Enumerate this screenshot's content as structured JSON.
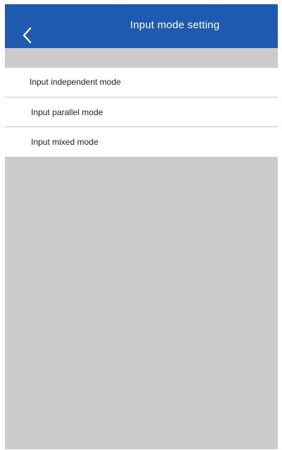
{
  "header": {
    "title": "Input mode setting",
    "back_icon": "chevron-left-icon"
  },
  "modes": [
    {
      "label": "Input independent mode"
    },
    {
      "label": "Input parallel mode"
    },
    {
      "label": "Input mixed mode"
    }
  ],
  "colors": {
    "header": "#1e5bb0",
    "background": "#cccccc",
    "list": "#ffffff",
    "divider": "#c4c4c4"
  }
}
